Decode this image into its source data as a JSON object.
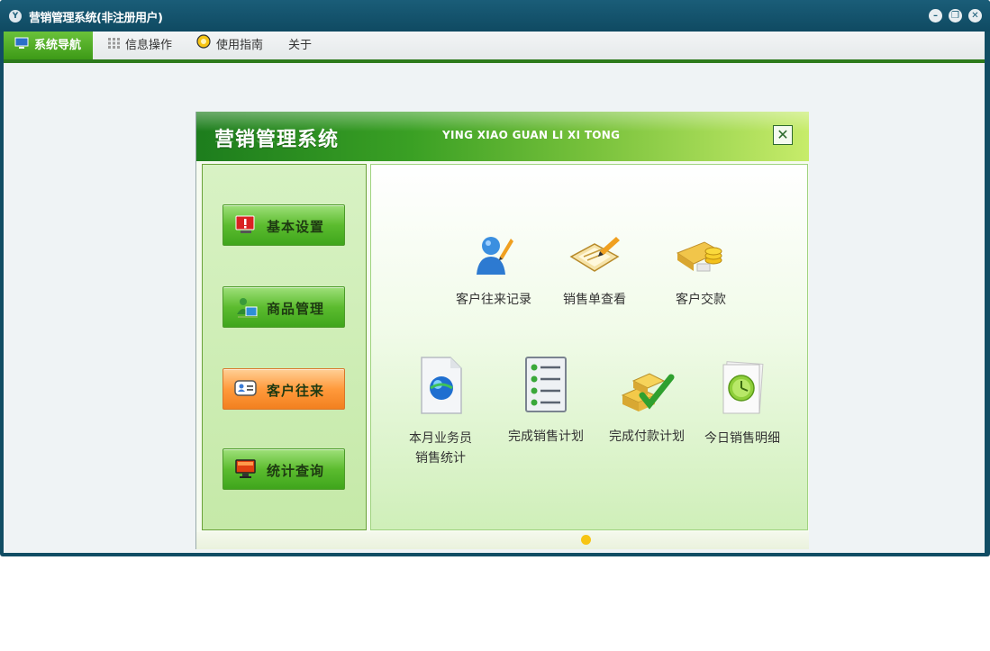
{
  "window": {
    "title": "营销管理系统(非注册用户)",
    "icon": "app-logo-icon",
    "controls": [
      "minimize-icon",
      "restore-icon",
      "close-icon"
    ]
  },
  "menu": {
    "items": [
      {
        "label": "系统导航",
        "icon": "monitor-icon",
        "active": true
      },
      {
        "label": "信息操作",
        "icon": "grid-icon",
        "active": false
      },
      {
        "label": "使用指南",
        "icon": "lightbulb-icon",
        "active": false
      },
      {
        "label": "关于",
        "icon": "",
        "active": false
      }
    ]
  },
  "dialog": {
    "title": "营销管理系统",
    "subtitle": "YING XIAO GUAN LI XI TONG",
    "close_icon": "close-icon",
    "nav": [
      {
        "label": "基本设置",
        "icon": "warning-monitor-icon",
        "active": false
      },
      {
        "label": "商品管理",
        "icon": "goods-icon",
        "active": false
      },
      {
        "label": "客户往来",
        "icon": "contact-card-icon",
        "active": true
      },
      {
        "label": "统计查询",
        "icon": "monitor-icon",
        "active": false
      }
    ],
    "functions": [
      {
        "label": "客户往来记录",
        "icon": "user-edit-icon"
      },
      {
        "label": "销售单查看",
        "icon": "notepad-pen-icon"
      },
      {
        "label": "客户交款",
        "icon": "coins-icon"
      },
      {
        "label": "本月业务员销售统计",
        "line1": "本月业务员",
        "line2": "销售统计",
        "icon": "globe-document-icon"
      },
      {
        "label": "完成销售计划",
        "icon": "checklist-icon"
      },
      {
        "label": "完成付款计划",
        "icon": "boxes-check-icon"
      },
      {
        "label": "今日销售明细",
        "icon": "clock-document-icon"
      }
    ]
  },
  "colors": {
    "titlebar": "#114d64",
    "accent_green": "#3d9a17",
    "active_orange": "#ff9a3c"
  }
}
